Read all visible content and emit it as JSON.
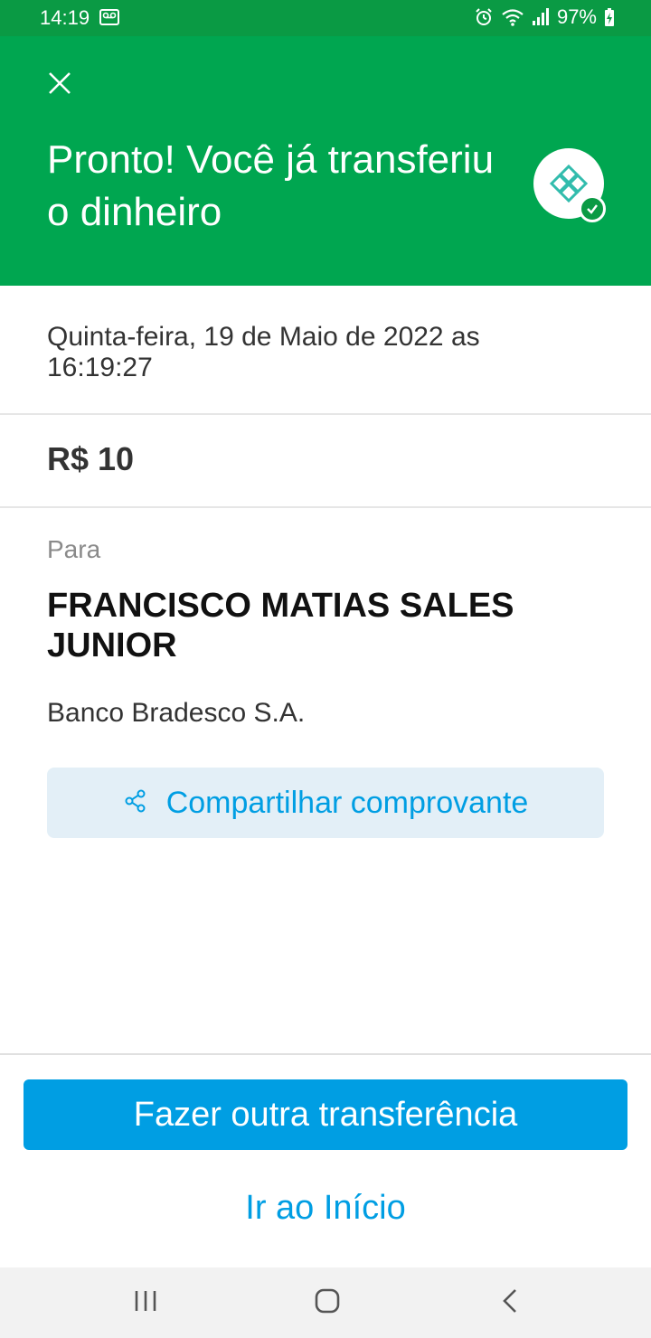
{
  "status_bar": {
    "time": "14:19",
    "battery": "97%"
  },
  "header": {
    "title": "Pronto! Você já transferiu o dinheiro",
    "badge_icon": "pix-logo-icon",
    "check_icon": "check-icon",
    "close_icon": "close-icon",
    "background_color": "#00a650"
  },
  "transfer": {
    "date": "Quinta-feira, 19 de Maio de 2022 as 16:19:27",
    "amount": "R$ 10",
    "to_label": "Para",
    "recipient": "FRANCISCO MATIAS SALES JUNIOR",
    "bank": "Banco Bradesco S.A."
  },
  "actions": {
    "share_label": "Compartilhar comprovante",
    "share_icon": "share-icon",
    "primary_label": "Fazer outra transferência",
    "secondary_label": "Ir ao Início",
    "accent_color": "#009ee3"
  },
  "nav_bar": {
    "recent_icon": "recent-apps-icon",
    "home_icon": "home-icon",
    "back_icon": "back-icon"
  }
}
